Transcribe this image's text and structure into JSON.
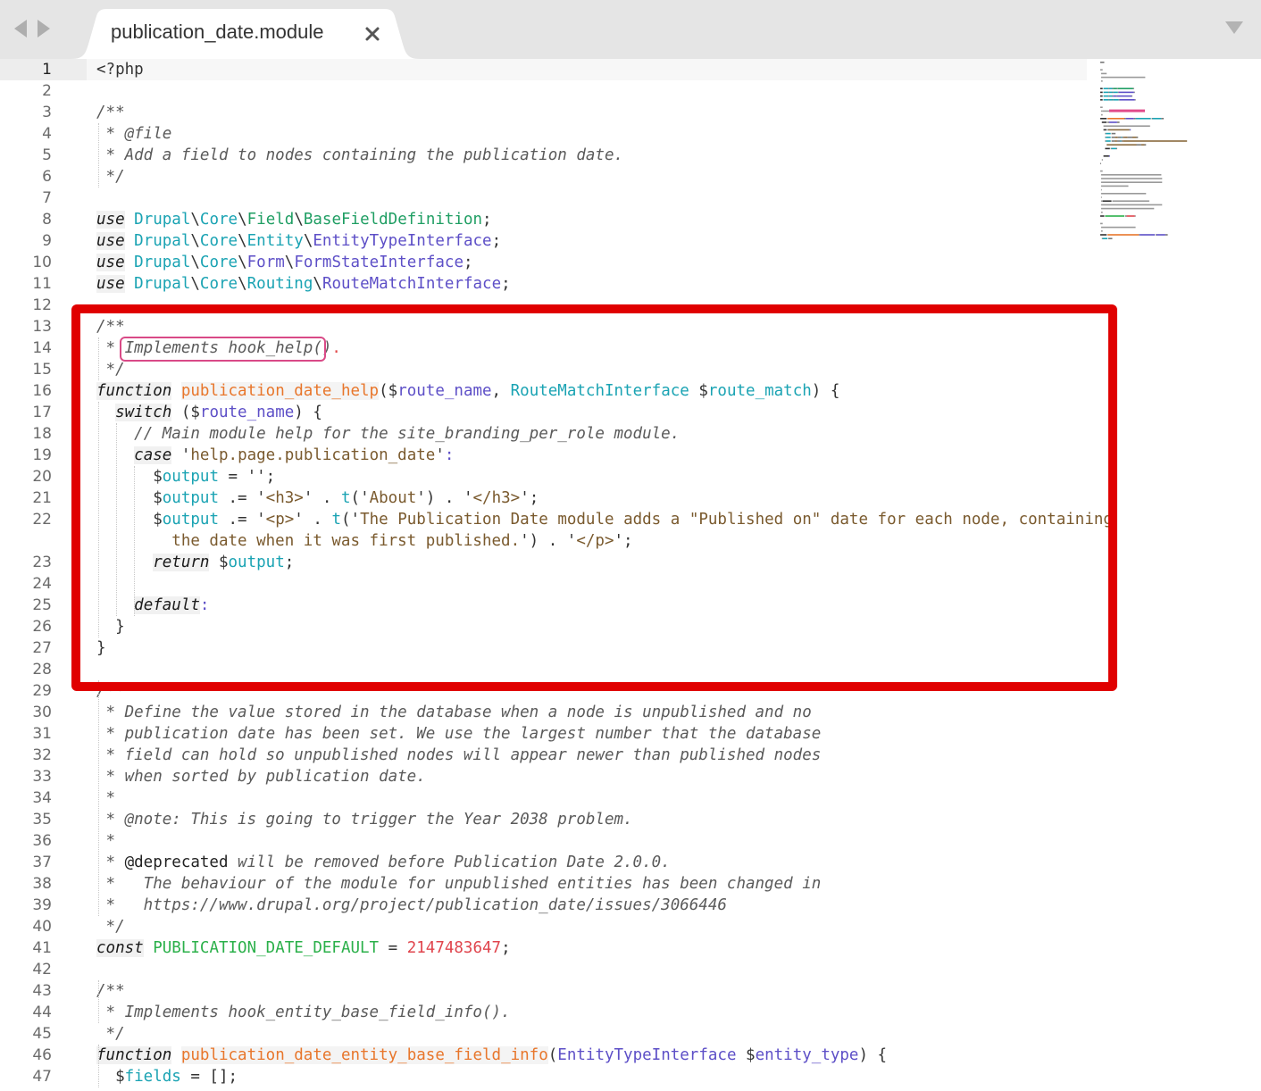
{
  "tab": {
    "title": "publication_date.module"
  },
  "lines": [
    {
      "n": "1",
      "tokens": [
        [
          "t-punct",
          "<?php"
        ]
      ]
    },
    {
      "n": "2",
      "tokens": []
    },
    {
      "n": "3",
      "tokens": [
        [
          "t-comment",
          "/**"
        ]
      ]
    },
    {
      "n": "4",
      "tokens": [
        [
          "t-comment",
          " * @file"
        ]
      ]
    },
    {
      "n": "5",
      "tokens": [
        [
          "t-comment",
          " * Add a field to nodes containing the publication date."
        ]
      ]
    },
    {
      "n": "6",
      "tokens": [
        [
          "t-comment",
          " */"
        ]
      ]
    },
    {
      "n": "7",
      "tokens": []
    },
    {
      "n": "8",
      "tokens": [
        [
          "t-kw",
          "use"
        ],
        [
          "t-punct",
          " "
        ],
        [
          "t-ns",
          "Drupal"
        ],
        [
          "t-punct",
          "\\"
        ],
        [
          "t-ns",
          "Core"
        ],
        [
          "t-punct",
          "\\"
        ],
        [
          "t-class",
          "Field"
        ],
        [
          "t-punct",
          "\\"
        ],
        [
          "t-class",
          "BaseFieldDefinition"
        ],
        [
          "t-punct",
          ";"
        ]
      ]
    },
    {
      "n": "9",
      "tokens": [
        [
          "t-kw",
          "use"
        ],
        [
          "t-punct",
          " "
        ],
        [
          "t-ns",
          "Drupal"
        ],
        [
          "t-punct",
          "\\"
        ],
        [
          "t-ns",
          "Core"
        ],
        [
          "t-punct",
          "\\"
        ],
        [
          "t-ns",
          "Entity"
        ],
        [
          "t-punct",
          "\\"
        ],
        [
          "t-type",
          "EntityTypeInterface"
        ],
        [
          "t-punct",
          ";"
        ]
      ]
    },
    {
      "n": "10",
      "tokens": [
        [
          "t-kw",
          "use"
        ],
        [
          "t-punct",
          " "
        ],
        [
          "t-ns",
          "Drupal"
        ],
        [
          "t-punct",
          "\\"
        ],
        [
          "t-ns",
          "Core"
        ],
        [
          "t-punct",
          "\\"
        ],
        [
          "t-type",
          "Form"
        ],
        [
          "t-punct",
          "\\"
        ],
        [
          "t-type",
          "FormStateInterface"
        ],
        [
          "t-punct",
          ";"
        ]
      ]
    },
    {
      "n": "11",
      "tokens": [
        [
          "t-kw",
          "use"
        ],
        [
          "t-punct",
          " "
        ],
        [
          "t-ns",
          "Drupal"
        ],
        [
          "t-punct",
          "\\"
        ],
        [
          "t-ns",
          "Core"
        ],
        [
          "t-punct",
          "\\"
        ],
        [
          "t-ns",
          "Routing"
        ],
        [
          "t-punct",
          "\\"
        ],
        [
          "t-type",
          "RouteMatchInterface"
        ],
        [
          "t-punct",
          ";"
        ]
      ]
    },
    {
      "n": "12",
      "tokens": []
    },
    {
      "n": "13",
      "tokens": [
        [
          "t-comment",
          "/**"
        ]
      ]
    },
    {
      "n": "14",
      "tokens": [
        [
          "t-comment",
          " * "
        ],
        [
          "t-comment",
          "Implements hook_help()"
        ],
        [
          "t-lightdot",
          "."
        ]
      ]
    },
    {
      "n": "15",
      "tokens": [
        [
          "t-comment",
          " */"
        ]
      ]
    },
    {
      "n": "16",
      "tokens": [
        [
          "t-kw",
          "function"
        ],
        [
          "t-punct",
          " "
        ],
        [
          "t-fn",
          "publication_date_help"
        ],
        [
          "t-punct",
          "($"
        ],
        [
          "t-type",
          "route_name"
        ],
        [
          "t-punct",
          ", "
        ],
        [
          "t-var",
          "RouteMatchInterface"
        ],
        [
          "t-punct",
          " $"
        ],
        [
          "t-var",
          "route_match"
        ],
        [
          "t-punct",
          ") {"
        ]
      ]
    },
    {
      "n": "17",
      "tokens": [
        [
          "t-punct",
          "  "
        ],
        [
          "t-kw",
          "switch"
        ],
        [
          "t-punct",
          " ($"
        ],
        [
          "t-type",
          "route_name"
        ],
        [
          "t-punct",
          ") {"
        ]
      ]
    },
    {
      "n": "18",
      "tokens": [
        [
          "t-punct",
          "    "
        ],
        [
          "t-comment",
          "// Main module help for the site_branding_per_role module."
        ]
      ]
    },
    {
      "n": "19",
      "tokens": [
        [
          "t-punct",
          "    "
        ],
        [
          "t-kw",
          "case"
        ],
        [
          "t-punct",
          " '"
        ],
        [
          "t-str",
          "help.page.publication_date"
        ],
        [
          "t-punct",
          "'"
        ],
        [
          "t-type",
          ":"
        ]
      ]
    },
    {
      "n": "20",
      "tokens": [
        [
          "t-punct",
          "      $"
        ],
        [
          "t-var",
          "output"
        ],
        [
          "t-punct",
          " = '';"
        ]
      ]
    },
    {
      "n": "21",
      "tokens": [
        [
          "t-punct",
          "      $"
        ],
        [
          "t-var",
          "output"
        ],
        [
          "t-punct",
          " .= '"
        ],
        [
          "t-str",
          "<h3>"
        ],
        [
          "t-punct",
          "' . "
        ],
        [
          "t-var",
          "t"
        ],
        [
          "t-punct",
          "('"
        ],
        [
          "t-str",
          "About"
        ],
        [
          "t-punct",
          "') . '"
        ],
        [
          "t-str",
          "</h3>"
        ],
        [
          "t-punct",
          "';"
        ]
      ]
    },
    {
      "n": "22",
      "tokens": [
        [
          "t-punct",
          "      $"
        ],
        [
          "t-var",
          "output"
        ],
        [
          "t-punct",
          " .= '"
        ],
        [
          "t-str",
          "<p>"
        ],
        [
          "t-punct",
          "' . "
        ],
        [
          "t-var",
          "t"
        ],
        [
          "t-punct",
          "('"
        ],
        [
          "t-str",
          "The Publication Date module adds a \"Published on\" date for each node, containing"
        ]
      ]
    },
    {
      "n": "",
      "tokens": [
        [
          "t-str",
          "        the date when it was first published."
        ],
        [
          "t-punct",
          "') . '"
        ],
        [
          "t-str",
          "</p>"
        ],
        [
          "t-punct",
          "';"
        ]
      ]
    },
    {
      "n": "23",
      "tokens": [
        [
          "t-punct",
          "      "
        ],
        [
          "t-kw",
          "return"
        ],
        [
          "t-punct",
          " $"
        ],
        [
          "t-var",
          "output"
        ],
        [
          "t-punct",
          ";"
        ]
      ]
    },
    {
      "n": "24",
      "tokens": []
    },
    {
      "n": "25",
      "tokens": [
        [
          "t-punct",
          "    "
        ],
        [
          "t-kw",
          "default"
        ],
        [
          "t-type",
          ":"
        ]
      ]
    },
    {
      "n": "26",
      "tokens": [
        [
          "t-punct",
          "  }"
        ]
      ]
    },
    {
      "n": "27",
      "tokens": [
        [
          "t-punct",
          "}"
        ]
      ]
    },
    {
      "n": "28",
      "tokens": []
    },
    {
      "n": "29",
      "tokens": [
        [
          "t-comment",
          "/**"
        ]
      ]
    },
    {
      "n": "30",
      "tokens": [
        [
          "t-comment",
          " * Define the value stored in the database when a node is unpublished and no"
        ]
      ]
    },
    {
      "n": "31",
      "tokens": [
        [
          "t-comment",
          " * publication date has been set. We use the largest number that the database"
        ]
      ]
    },
    {
      "n": "32",
      "tokens": [
        [
          "t-comment",
          " * field can hold so unpublished nodes will appear newer than published nodes"
        ]
      ]
    },
    {
      "n": "33",
      "tokens": [
        [
          "t-comment",
          " * when sorted by publication date."
        ]
      ]
    },
    {
      "n": "34",
      "tokens": [
        [
          "t-comment",
          " *"
        ]
      ]
    },
    {
      "n": "35",
      "tokens": [
        [
          "t-comment",
          " * @note: This is going to trigger the Year 2038 problem."
        ]
      ]
    },
    {
      "n": "36",
      "tokens": [
        [
          "t-comment",
          " *"
        ]
      ]
    },
    {
      "n": "37",
      "tokens": [
        [
          "t-comment",
          " * "
        ],
        [
          "t-tag",
          "@deprecated"
        ],
        [
          "t-comment",
          " will be removed before Publication Date 2.0.0."
        ]
      ]
    },
    {
      "n": "38",
      "tokens": [
        [
          "t-comment",
          " *   The behaviour of the module for unpublished entities has been changed in"
        ]
      ]
    },
    {
      "n": "39",
      "tokens": [
        [
          "t-comment",
          " *   https://www.drupal.org/project/publication_date/issues/3066446"
        ]
      ]
    },
    {
      "n": "40",
      "tokens": [
        [
          "t-comment",
          " */"
        ]
      ]
    },
    {
      "n": "41",
      "tokens": [
        [
          "t-kw",
          "const"
        ],
        [
          "t-punct",
          " "
        ],
        [
          "t-const",
          "PUBLICATION_DATE_DEFAULT"
        ],
        [
          "t-punct",
          " = "
        ],
        [
          "t-num",
          "2147483647"
        ],
        [
          "t-punct",
          ";"
        ]
      ]
    },
    {
      "n": "42",
      "tokens": []
    },
    {
      "n": "43",
      "tokens": [
        [
          "t-comment",
          "/**"
        ]
      ]
    },
    {
      "n": "44",
      "tokens": [
        [
          "t-comment",
          " * Implements hook_entity_base_field_info()."
        ]
      ]
    },
    {
      "n": "45",
      "tokens": [
        [
          "t-comment",
          " */"
        ]
      ]
    },
    {
      "n": "46",
      "tokens": [
        [
          "t-kw",
          "function"
        ],
        [
          "t-punct",
          " "
        ],
        [
          "t-fn",
          "publication_date_entity_base_field_info"
        ],
        [
          "t-punct",
          "("
        ],
        [
          "t-type",
          "EntityTypeInterface"
        ],
        [
          "t-punct",
          " $"
        ],
        [
          "t-type",
          "entity_type"
        ],
        [
          "t-punct",
          ") {"
        ]
      ]
    },
    {
      "n": "47",
      "tokens": [
        [
          "t-punct",
          "  $"
        ],
        [
          "t-var",
          "fields"
        ],
        [
          "t-punct",
          " = [];"
        ]
      ]
    }
  ],
  "colors": {
    "highlight_border": "#e00000",
    "pink_annotation": "#d94a87",
    "tab_bar": "#e5e5e5"
  }
}
